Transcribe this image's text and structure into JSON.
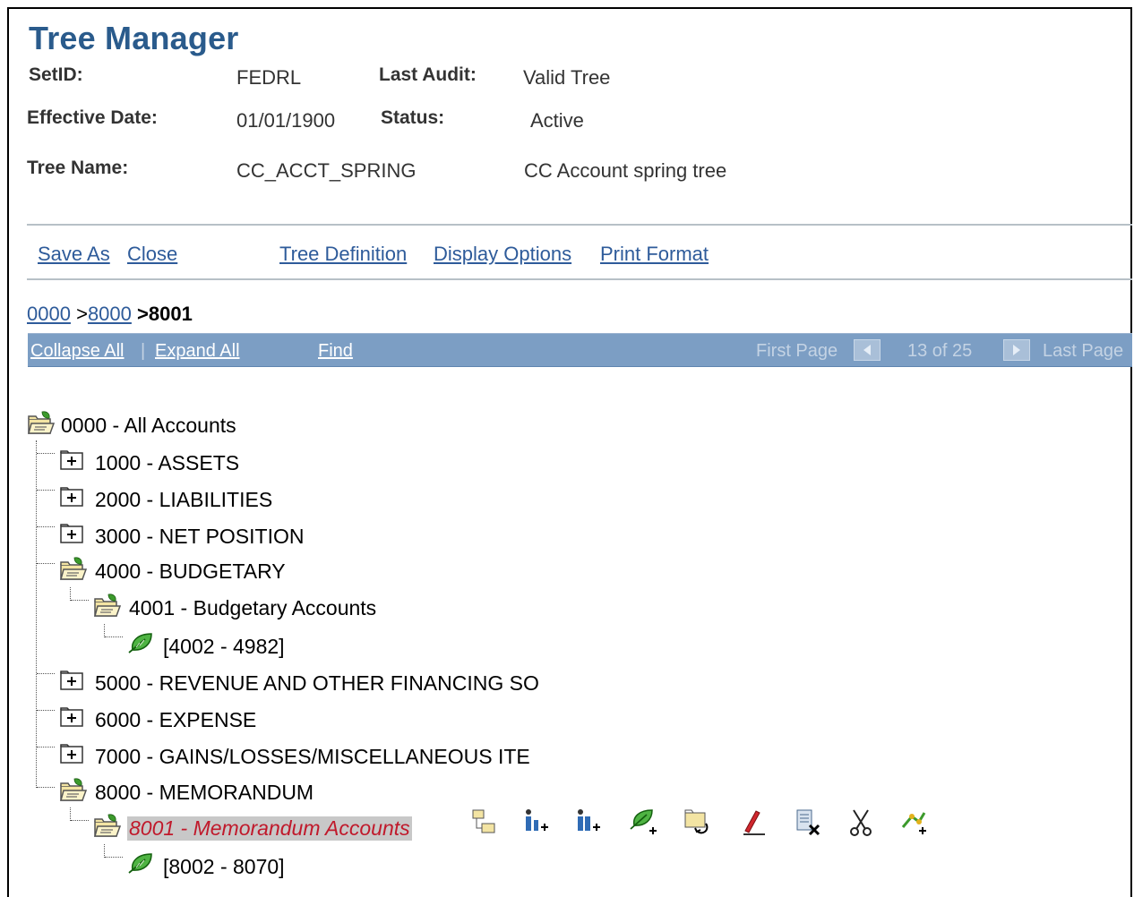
{
  "page": {
    "title": "Tree Manager"
  },
  "header": {
    "setid_label": "SetID:",
    "setid_value": "FEDRL",
    "last_audit_label": "Last Audit:",
    "last_audit_value": "Valid Tree",
    "effective_date_label": "Effective Date:",
    "effective_date_value": "01/01/1900",
    "status_label": "Status:",
    "status_value": "Active",
    "tree_name_label": "Tree Name:",
    "tree_name_value": "CC_ACCT_SPRING",
    "tree_description": "CC Account spring tree"
  },
  "actions": {
    "save_as": "Save As",
    "close": "Close",
    "tree_definition": "Tree Definition",
    "display_options": "Display Options",
    "print_format": "Print Format"
  },
  "breadcrumb": {
    "items": [
      "0000",
      ">",
      "8000",
      ">8001"
    ]
  },
  "navbar": {
    "collapse_all": "Collapse All",
    "separator": "|",
    "expand_all": "Expand All",
    "find": "Find",
    "first_page": "First Page",
    "page_count": "13 of 25",
    "last_page": "Last Page"
  },
  "tree": {
    "nodes": [
      {
        "label": "0000 - All Accounts",
        "icon": "open-folder-icon"
      },
      {
        "label": "1000 - ASSETS",
        "icon": "expand-plus-icon"
      },
      {
        "label": "2000 - LIABILITIES",
        "icon": "expand-plus-icon"
      },
      {
        "label": "3000 - NET POSITION",
        "icon": "expand-plus-icon"
      },
      {
        "label": "4000 - BUDGETARY",
        "icon": "open-folder-icon"
      },
      {
        "label": "4001 - Budgetary Accounts",
        "icon": "open-folder-icon"
      },
      {
        "label": "[4002 - 4982]",
        "icon": "leaf-icon"
      },
      {
        "label": "5000 - REVENUE AND OTHER FINANCING SO",
        "icon": "expand-plus-icon"
      },
      {
        "label": "6000 - EXPENSE",
        "icon": "expand-plus-icon"
      },
      {
        "label": "7000 - GAINS/LOSSES/MISCELLANEOUS ITE",
        "icon": "expand-plus-icon"
      },
      {
        "label": "8000 - MEMORANDUM",
        "icon": "open-folder-icon"
      },
      {
        "label": "8001 - Memorandum Accounts",
        "icon": "open-folder-icon",
        "selected": true
      },
      {
        "label": "[8002 - 8070]",
        "icon": "leaf-icon"
      }
    ]
  },
  "toolbar": {
    "icons": [
      "insert-sibling-node-icon",
      "insert-child-node-icon",
      "insert-sibling-detail-icon",
      "insert-leaf-icon",
      "move-node-icon",
      "edit-data-icon",
      "delete-node-icon",
      "cut-icon",
      "paste-icon"
    ]
  },
  "colors": {
    "title": "#2a5b8c",
    "link": "#2e5b9a",
    "navbar": "#7c9ec4",
    "selected_text": "#c0192b",
    "selected_bg": "#c8c8c8"
  }
}
